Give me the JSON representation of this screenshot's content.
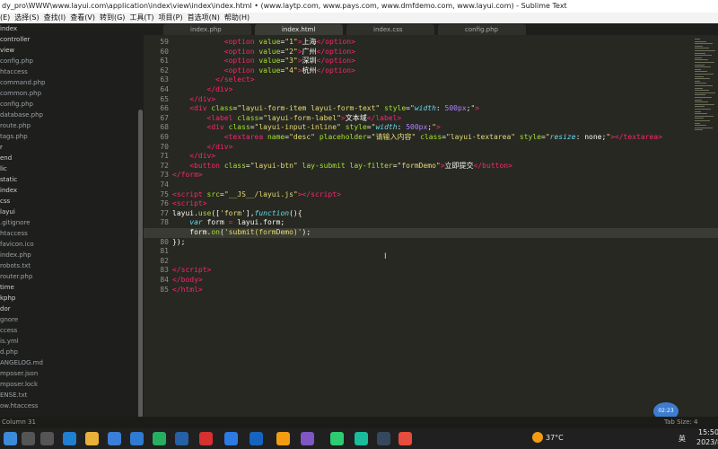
{
  "window": {
    "title": "dy_pro\\WWW\\www.layui.com\\application\\index\\view\\index\\index.html • (www.laytp.com, www.pays.com, www.dmfdemo.com, www.layui.com) - Sublime Text"
  },
  "menu": [
    "(E)",
    "选择(S)",
    "查找(I)",
    "查看(V)",
    "转到(G)",
    "工具(T)",
    "项目(P)",
    "首选项(N)",
    "帮助(H)"
  ],
  "sidebar": [
    {
      "label": "index",
      "dir": true
    },
    {
      "label": "controller",
      "dir": true
    },
    {
      "label": "view",
      "dir": true
    },
    {
      "label": "config.php"
    },
    {
      "label": "htaccess"
    },
    {
      "label": "command.php"
    },
    {
      "label": "common.php"
    },
    {
      "label": "config.php"
    },
    {
      "label": "database.php"
    },
    {
      "label": "route.php"
    },
    {
      "label": "tags.php"
    },
    {
      "label": "r",
      "dir": true
    },
    {
      "label": "end",
      "dir": true
    },
    {
      "label": "lic",
      "dir": true
    },
    {
      "label": "static",
      "dir": true
    },
    {
      "label": "index",
      "dir": true
    },
    {
      "label": "css",
      "dir": true
    },
    {
      "label": "layui",
      "dir": true
    },
    {
      "label": ".gitignore"
    },
    {
      "label": "htaccess"
    },
    {
      "label": "favicon.ico"
    },
    {
      "label": "index.php"
    },
    {
      "label": "robots.txt"
    },
    {
      "label": "router.php"
    },
    {
      "label": "time",
      "dir": true
    },
    {
      "label": "kphp",
      "dir": true
    },
    {
      "label": "dor",
      "dir": true
    },
    {
      "label": "gnore"
    },
    {
      "label": "ccess"
    },
    {
      "label": "is.yml"
    },
    {
      "label": "d.php"
    },
    {
      "label": "ANGELOG.md"
    },
    {
      "label": "mposer.json"
    },
    {
      "label": "mposer.lock"
    },
    {
      "label": "ENSE.txt"
    },
    {
      "label": "ow.htaccess"
    }
  ],
  "tabs": [
    {
      "label": "index.php",
      "active": false
    },
    {
      "label": "index.html",
      "active": true
    },
    {
      "label": "index.css",
      "active": false
    },
    {
      "label": "config.php",
      "active": false
    }
  ],
  "code": [
    {
      "n": "59",
      "html": "            <span class=\"t\">&lt;option</span> <span class=\"a\">value</span>=<span class=\"s\">\"1\"</span><span class=\"t\">&gt;</span>上海<span class=\"t\">&lt;/option&gt;</span>"
    },
    {
      "n": "60",
      "html": "            <span class=\"t\">&lt;option</span> <span class=\"a\">value</span>=<span class=\"s\">\"2\"</span><span class=\"t\">&gt;</span>广州<span class=\"t\">&lt;/option&gt;</span>"
    },
    {
      "n": "61",
      "html": "            <span class=\"t\">&lt;option</span> <span class=\"a\">value</span>=<span class=\"s\">\"3\"</span><span class=\"t\">&gt;</span>深圳<span class=\"t\">&lt;/option&gt;</span>"
    },
    {
      "n": "62",
      "html": "            <span class=\"t\">&lt;option</span> <span class=\"a\">value</span>=<span class=\"s\">\"4\"</span><span class=\"t\">&gt;</span>杭州<span class=\"t\">&lt;/option&gt;</span>"
    },
    {
      "n": "63",
      "html": "          <span class=\"t\">&lt;/select&gt;</span>"
    },
    {
      "n": "64",
      "html": "        <span class=\"t\">&lt;/div&gt;</span>"
    },
    {
      "n": "65",
      "html": "    <span class=\"t\">&lt;/div&gt;</span>"
    },
    {
      "n": "66",
      "html": "    <span class=\"t\">&lt;div</span> <span class=\"a\">class</span>=<span class=\"s\">\"layui-form-item layui-form-text\"</span> <span class=\"a\">style</span>=<span class=\"s\">\"</span><span class=\"k\">width</span>: <span class=\"c\">500px</span>;<span class=\"s\">\"</span><span class=\"t\">&gt;</span>"
    },
    {
      "n": "67",
      "html": "        <span class=\"t\">&lt;label</span> <span class=\"a\">class</span>=<span class=\"s\">\"layui-form-label\"</span><span class=\"t\">&gt;</span>文本域<span class=\"t\">&lt;/label&gt;</span>"
    },
    {
      "n": "68",
      "html": "        <span class=\"t\">&lt;div</span> <span class=\"a\">class</span>=<span class=\"s\">\"layui-input-inline\"</span> <span class=\"a\">style</span>=<span class=\"s\">\"</span><span class=\"k\">width</span>: <span class=\"c\">500px</span>;<span class=\"s\">\"</span><span class=\"t\">&gt;</span>"
    },
    {
      "n": "69",
      "html": "            <span class=\"t\">&lt;textarea</span> <span class=\"a\">name</span>=<span class=\"s\">\"desc\"</span> <span class=\"a\">placeholder</span>=<span class=\"s\">\"请输入内容\"</span> <span class=\"a\">class</span>=<span class=\"s\">\"layui-textarea\"</span> <span class=\"a\">style</span>=<span class=\"s\">\"</span><span class=\"k\">resize</span>: none;<span class=\"s\">\"</span><span class=\"t\">&gt;&lt;/textarea&gt;</span>"
    },
    {
      "n": "70",
      "html": "        <span class=\"t\">&lt;/div&gt;</span>"
    },
    {
      "n": "71",
      "html": "    <span class=\"t\">&lt;/div&gt;</span>"
    },
    {
      "n": "72",
      "html": "    <span class=\"t\">&lt;button</span> <span class=\"a\">class</span>=<span class=\"s\">\"layui-btn\"</span> <span class=\"a\">lay-submit</span> <span class=\"a\">lay-filter</span>=<span class=\"s\">\"formDemo\"</span><span class=\"t\">&gt;</span>立即提交<span class=\"t\">&lt;/button&gt;</span>"
    },
    {
      "n": "73",
      "html": "<span class=\"t\">&lt;/form&gt;</span>"
    },
    {
      "n": "74",
      "html": ""
    },
    {
      "n": "75",
      "html": "<span class=\"t\">&lt;script</span> <span class=\"a\">src</span>=<span class=\"s\">\"__JS__/layui.js\"</span><span class=\"t\">&gt;&lt;/script&gt;</span>"
    },
    {
      "n": "76",
      "html": "<span class=\"t\">&lt;script&gt;</span>"
    },
    {
      "n": "77",
      "html": "layui.<span class=\"a\">use</span>([<span class=\"s\">'form'</span>],<span class=\"k\">function</span>(){"
    },
    {
      "n": "78",
      "html": "    <span class=\"k\">var</span> form <span class=\"t\">=</span> layui.form;"
    },
    {
      "n": "79",
      "html": "    form.<span class=\"a\">on</span>(<span class=\"s\">'submit(formDemo)'</span>);",
      "current": true
    },
    {
      "n": "80",
      "html": "});"
    },
    {
      "n": "81",
      "html": ""
    },
    {
      "n": "82",
      "html": ""
    },
    {
      "n": "83",
      "html": "<span class=\"t\">&lt;/script&gt;</span>"
    },
    {
      "n": "84",
      "html": "<span class=\"t\">&lt;/body&gt;</span>"
    },
    {
      "n": "85",
      "html": "<span class=\"t\">&lt;/html&gt;</span>"
    }
  ],
  "status": {
    "position": "Column 31",
    "tab_size": "Tab Size: 4"
  },
  "badge": "02:23",
  "tray": {
    "weather": "37°C",
    "time": "15:50",
    "date": "2023/8",
    "ime": "英"
  },
  "taskbar_icons": [
    "windows-icon",
    "search-icon",
    "task-view-icon",
    "edge-icon",
    "file-explorer-icon",
    "store-icon",
    "mail-icon",
    "pycharm-icon",
    "photoshop-icon",
    "wps-icon",
    "feishu-icon",
    "p-app-icon",
    "sublime-icon",
    "visual-studio-icon",
    "wechat-icon",
    "qq-icon",
    "obs-icon",
    "chrome-icon"
  ]
}
